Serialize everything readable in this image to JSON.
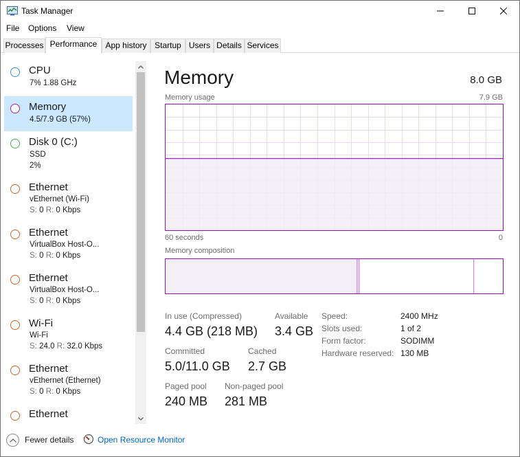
{
  "window": {
    "title": "Task Manager"
  },
  "menu": [
    "File",
    "Options",
    "View"
  ],
  "tabs": [
    "Processes",
    "Performance",
    "App history",
    "Startup",
    "Users",
    "Details",
    "Services"
  ],
  "active_tab": "Performance",
  "resources": [
    {
      "title": "CPU",
      "line1": "7%  1.88 GHz",
      "color": "#3b8fd0",
      "selected": false
    },
    {
      "title": "Memory",
      "line1": "4.5/7.9 GB (57%)",
      "color": "#a020b8",
      "selected": true
    },
    {
      "title": "Disk 0 (C:)",
      "line1": "SSD",
      "line2": "2%",
      "color": "#4caf50",
      "selected": false
    },
    {
      "title": "Ethernet",
      "line1": "vEthernet (Wi-Fi)",
      "s_label": "S:",
      "s_value": "0",
      "r_label": "R:",
      "r_value": "0 Kbps",
      "color": "#c8682a",
      "selected": false
    },
    {
      "title": "Ethernet",
      "line1": "VirtualBox Host-O...",
      "s_label": "S:",
      "s_value": "0",
      "r_label": "R:",
      "r_value": "0 Kbps",
      "color": "#c8682a",
      "selected": false
    },
    {
      "title": "Ethernet",
      "line1": "VirtualBox Host-O...",
      "s_label": "S:",
      "s_value": "0",
      "r_label": "R:",
      "r_value": "0 Kbps",
      "color": "#c8682a",
      "selected": false
    },
    {
      "title": "Wi-Fi",
      "line1": "Wi-Fi",
      "s_label": "S:",
      "s_value": "24.0",
      "r_label": "R:",
      "r_value": "32.0 Kbps",
      "color": "#c8682a",
      "selected": false
    },
    {
      "title": "Ethernet",
      "line1": "vEthernet (Ethernet)",
      "s_label": "S:",
      "s_value": "0",
      "r_label": "R:",
      "r_value": "0 Kbps",
      "color": "#c8682a",
      "selected": false
    },
    {
      "title": "Ethernet",
      "color": "#c8682a",
      "selected": false
    }
  ],
  "memory": {
    "title": "Memory",
    "total": "8.0 GB",
    "usage_label": "Memory usage",
    "usage_max": "7.9 GB",
    "x_left": "60 seconds",
    "x_right": "0",
    "usage_fraction": 0.57,
    "composition_label": "Memory composition",
    "composition": {
      "in_use_fraction": 0.568,
      "modified_fraction": 0.006,
      "standby_fraction": 0.34
    },
    "stats": {
      "in_use_label": "In use (Compressed)",
      "in_use_value": "4.4 GB (218 MB)",
      "available_label": "Available",
      "available_value": "3.4 GB",
      "committed_label": "Committed",
      "committed_value": "5.0/11.0 GB",
      "cached_label": "Cached",
      "cached_value": "2.7 GB",
      "paged_label": "Paged pool",
      "paged_value": "240 MB",
      "nonpaged_label": "Non-paged pool",
      "nonpaged_value": "281 MB"
    },
    "details": [
      {
        "label": "Speed:",
        "value": "2400 MHz"
      },
      {
        "label": "Slots used:",
        "value": "1 of 2"
      },
      {
        "label": "Form factor:",
        "value": "SODIMM"
      },
      {
        "label": "Hardware reserved:",
        "value": "130 MB"
      }
    ],
    "accent_color": "#8b12ae"
  },
  "footer": {
    "fewer_details": "Fewer details",
    "open_resource_monitor": "Open Resource Monitor"
  }
}
